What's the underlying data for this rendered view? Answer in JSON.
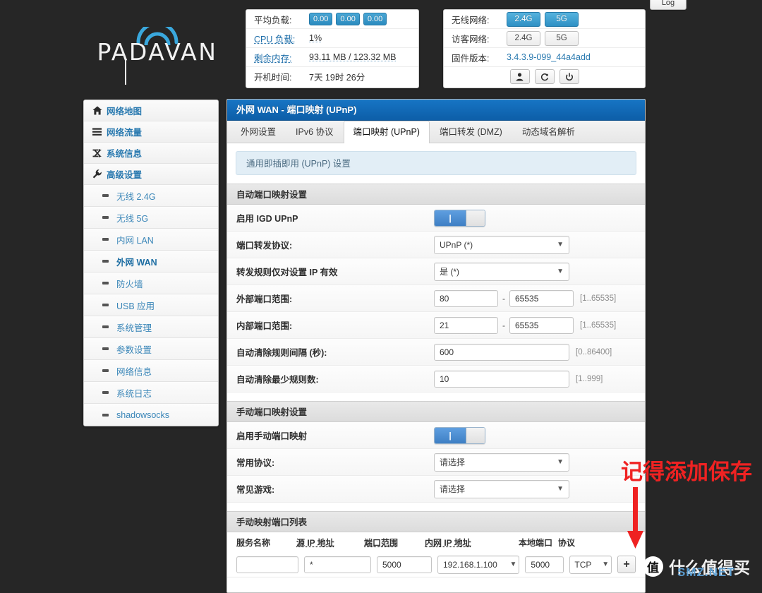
{
  "topbar": {
    "log_label": "Log"
  },
  "logo": {
    "text": "PADAVAN"
  },
  "status_left": {
    "rows": [
      {
        "label": "平均负载:",
        "badges": [
          "0.00",
          "0.00",
          "0.00"
        ]
      },
      {
        "label": "CPU 负载:",
        "value": "1%"
      },
      {
        "label": "剩余内存:",
        "value": "93.11 MB / 123.32 MB"
      },
      {
        "label": "开机时间:",
        "value": "7天 19时 26分"
      }
    ]
  },
  "status_right": {
    "wireless_label": "无线网络:",
    "wireless_buttons": [
      {
        "label": "2.4G",
        "on": true
      },
      {
        "label": "5G",
        "on": true
      }
    ],
    "guest_label": "访客网络:",
    "guest_buttons": [
      {
        "label": "2.4G",
        "on": false
      },
      {
        "label": "5G",
        "on": false
      }
    ],
    "firmware_label": "固件版本:",
    "firmware_value": "3.4.3.9-099_44a4add",
    "actions": [
      "user-icon",
      "refresh-icon",
      "power-icon"
    ],
    "action_glyphs": [
      "♟",
      "↻",
      "⏻"
    ]
  },
  "sidebar": {
    "items": [
      {
        "label": "网络地图",
        "icon": "home-icon",
        "glyph": "⌂",
        "sub": false
      },
      {
        "label": "网络流量",
        "icon": "bars-icon",
        "glyph": "☰",
        "sub": false
      },
      {
        "label": "系统信息",
        "icon": "shuffle-icon",
        "glyph": "⤨",
        "sub": false
      },
      {
        "label": "高级设置",
        "icon": "wrench-icon",
        "glyph": "⚒",
        "sub": false
      },
      {
        "label": "无线 2.4G",
        "sub": true,
        "active": false
      },
      {
        "label": "无线 5G",
        "sub": true,
        "active": false
      },
      {
        "label": "内网 LAN",
        "sub": true,
        "active": false
      },
      {
        "label": "外网 WAN",
        "sub": true,
        "active": true
      },
      {
        "label": "防火墙",
        "sub": true,
        "active": false
      },
      {
        "label": "USB 应用",
        "sub": true,
        "active": false
      },
      {
        "label": "系统管理",
        "sub": true,
        "active": false
      },
      {
        "label": "参数设置",
        "sub": true,
        "active": false
      },
      {
        "label": "网络信息",
        "sub": true,
        "active": false
      },
      {
        "label": "系统日志",
        "sub": true,
        "active": false
      },
      {
        "label": "shadowsocks",
        "sub": true,
        "active": false
      }
    ]
  },
  "main": {
    "title": "外网 WAN - 端口映射 (UPnP)",
    "tabs": [
      {
        "label": "外网设置",
        "active": false
      },
      {
        "label": "IPv6 协议",
        "active": false
      },
      {
        "label": "端口映射 (UPnP)",
        "active": true
      },
      {
        "label": "端口转发 (DMZ)",
        "active": false
      },
      {
        "label": "动态域名解析",
        "active": false
      }
    ],
    "subhead": "通用即插即用 (UPnP) 设置",
    "section_auto": "自动端口映射设置",
    "auto_rows": {
      "igd_label": "启用 IGD UPnP",
      "igd_toggle_on": true,
      "protocol_label": "端口转发协议:",
      "protocol_value": "UPnP (*)",
      "rule_ip_label": "转发规则仅对设置 IP 有效",
      "rule_ip_value": "是 (*)",
      "ext_range_label": "外部端口范围:",
      "ext_range_from": "80",
      "ext_range_to": "65535",
      "ext_range_hint": "[1..65535]",
      "int_range_label": "内部端口范围:",
      "int_range_from": "21",
      "int_range_to": "65535",
      "int_range_hint": "[1..65535]",
      "clean_interval_label": "自动清除规则间隔 (秒):",
      "clean_interval_value": "600",
      "clean_interval_hint": "[0..86400]",
      "clean_min_label": "自动清除最少规则数:",
      "clean_min_value": "10",
      "clean_min_hint": "[1..999]"
    },
    "section_manual": "手动端口映射设置",
    "manual_rows": {
      "enable_label": "启用手动端口映射",
      "enable_toggle_on": true,
      "common_proto_label": "常用协议:",
      "common_proto_value": "请选择",
      "common_game_label": "常见游戏:",
      "common_game_value": "请选择"
    },
    "section_list": "手动映射端口列表",
    "table": {
      "headers": [
        "服务名称",
        "源 IP 地址",
        "端口范围",
        "内网 IP 地址",
        "本地端口",
        "协议"
      ],
      "row": {
        "service_name": "",
        "source_ip": "*",
        "port_range": "5000",
        "lan_ip": "192.168.1.100",
        "local_port": "5000",
        "protocol": "TCP",
        "add_label": "+"
      }
    }
  },
  "annotation": {
    "text": "记得添加保存",
    "color": "#ef2222"
  },
  "watermark": {
    "logo": "值",
    "text": "什么值得买",
    "sub": "SMZ.NET"
  }
}
